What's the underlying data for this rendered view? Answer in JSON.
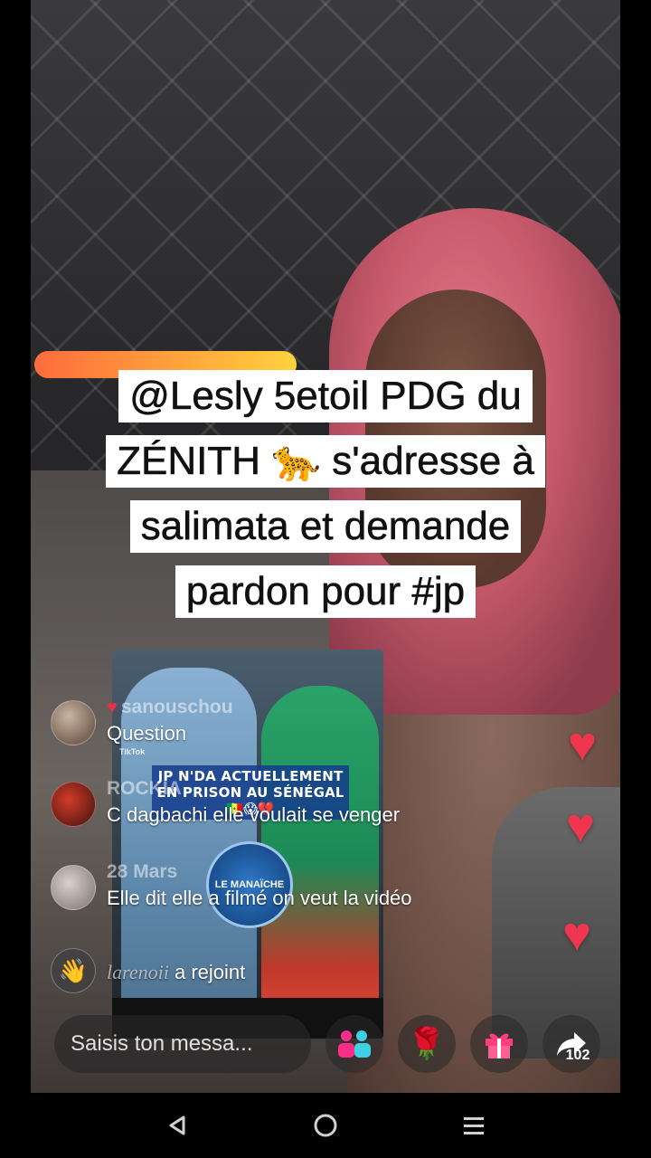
{
  "caption": {
    "lines": [
      "@Lesly 5etoil PDG du",
      "ZÉNITH 🐆 s'adresse à",
      "salimata et demande",
      "pardon pour #jp"
    ]
  },
  "inset_video": {
    "headline": "JP N'DA ACTUELLEMENT EN PRISON AU SÉNÉGAL 🇸🇳😱💔",
    "watermark": "TikTok",
    "logo_text": "LE MANAÏCHE"
  },
  "comments": [
    {
      "user": "sanouschou",
      "text": "Question"
    },
    {
      "user": "ROCKIA",
      "text": "C dagbachi elle voulait se venger"
    },
    {
      "user": "28 Mars",
      "text": "Elle dit elle a filmé on veut la vidéo"
    }
  ],
  "join_event": {
    "user": "larenoii",
    "text": "a rejoint"
  },
  "message_input": {
    "placeholder": "Saisis ton messa..."
  },
  "actions": {
    "share_count": "102",
    "icons": [
      "multiguest-icon",
      "rose-icon",
      "gift-icon",
      "share-icon"
    ]
  },
  "colors": {
    "heart": "#f0364e",
    "hair": "#c85a6c"
  }
}
